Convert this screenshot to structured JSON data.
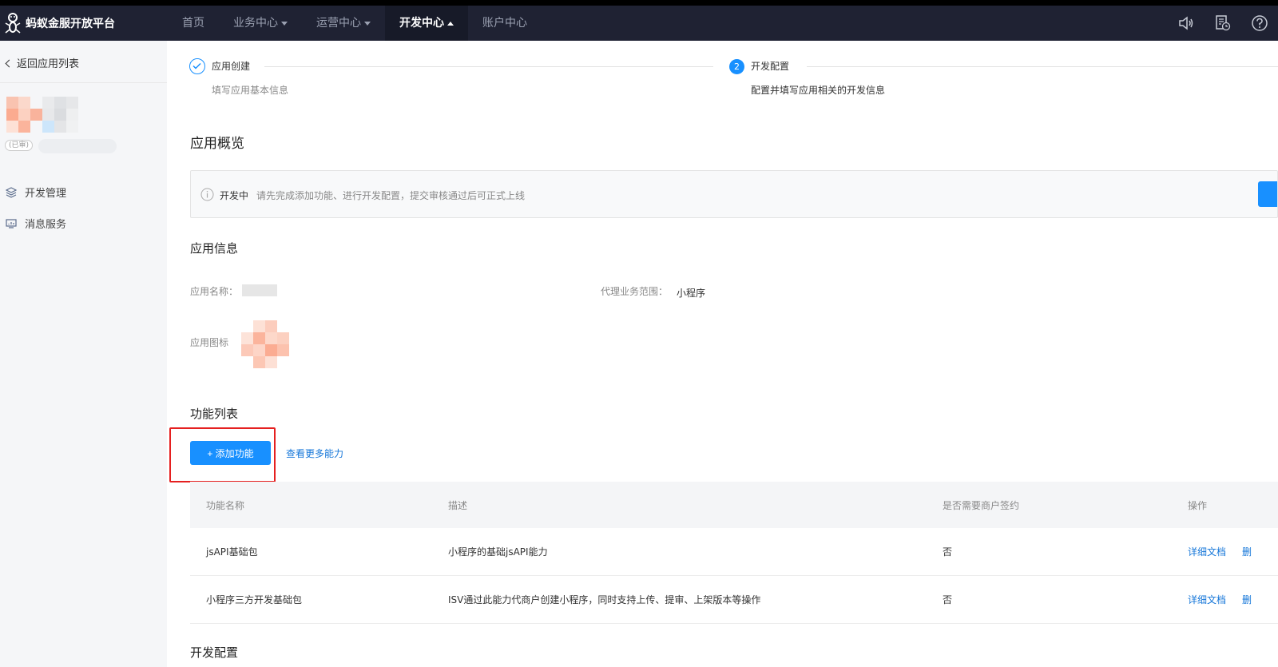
{
  "topbar": {
    "brand": "蚂蚁金服开放平台",
    "nav": [
      {
        "label": "首页",
        "dropdown": false,
        "active": false
      },
      {
        "label": "业务中心",
        "dropdown": true,
        "active": false
      },
      {
        "label": "运营中心",
        "dropdown": true,
        "active": false
      },
      {
        "label": "开发中心",
        "dropdown": true,
        "active": true
      },
      {
        "label": "账户中心",
        "dropdown": false,
        "active": false
      }
    ],
    "icons": [
      "speaker-icon",
      "document-clock-icon",
      "help-icon"
    ],
    "colors": {
      "background": "#1f2233",
      "active_bg": "#171a28"
    }
  },
  "sidebar": {
    "back_label": "返回应用列表",
    "app_tag": "(已审)",
    "menu": [
      {
        "label": "开发管理",
        "icon": "layers-icon"
      },
      {
        "label": "消息服务",
        "icon": "monitor-icon"
      }
    ]
  },
  "steps": [
    {
      "title": "应用创建",
      "desc": "填写应用基本信息",
      "state": "done"
    },
    {
      "number": "2",
      "title": "开发配置",
      "desc": "配置并填写应用相关的开发信息",
      "state": "current"
    }
  ],
  "overview": {
    "title": "应用概览",
    "status": "开发中",
    "message": "请先完成添加功能、进行开发配置，提交审核通过后可正式上线"
  },
  "app_info": {
    "title": "应用信息",
    "name_label": "应用名称：",
    "scope_label": "代理业务范围：",
    "scope_value": "小程序",
    "icon_label": "应用图标"
  },
  "features": {
    "title": "功能列表",
    "add_button": "+ 添加功能",
    "more_link": "查看更多能力",
    "headers": [
      "功能名称",
      "描述",
      "是否需要商户签约",
      "操作"
    ],
    "rows": [
      {
        "name": "jsAPI基础包",
        "desc": "小程序的基础jsAPI能力",
        "sign": "否",
        "doc": "详细文档",
        "del": "删"
      },
      {
        "name": "小程序三方开发基础包",
        "desc": "ISV通过此能力代商户创建小程序，同时支持上传、提审、上架版本等操作",
        "sign": "否",
        "doc": "详细文档",
        "del": "删"
      }
    ]
  },
  "next_section": "开发配置",
  "accent": "#1890ff"
}
